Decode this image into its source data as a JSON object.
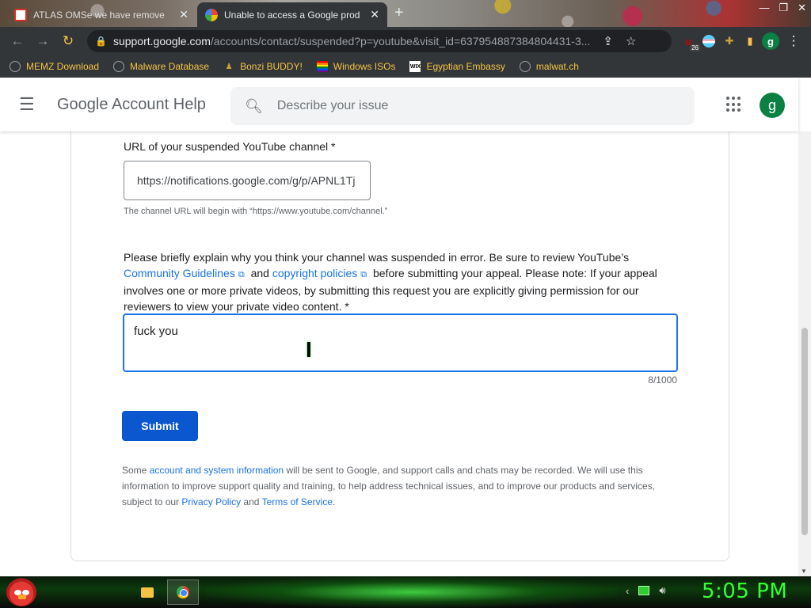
{
  "browser": {
    "tabs": [
      {
        "title": "ATLAS OMSe we have remove",
        "active": false
      },
      {
        "title": "Unable to access a Google prod",
        "active": true
      }
    ],
    "url_host": "support.google.com",
    "url_path": "/accounts/contact/suspended?p=youtube&visit_id=637954887384804431-3...",
    "extension_badge": "26",
    "profile_initial": "g",
    "bookmarks": [
      {
        "label": "MEMZ Download",
        "icon": "globe-icon"
      },
      {
        "label": "Malware Database",
        "icon": "globe-icon"
      },
      {
        "label": "Bonzi BUDDY!",
        "icon": "bonzi-icon"
      },
      {
        "label": "Windows ISOs",
        "icon": "rainbow-flag-icon"
      },
      {
        "label": "Egyptian Embassy",
        "icon": "wix-icon"
      },
      {
        "label": "malwat.ch",
        "icon": "globe-icon"
      }
    ]
  },
  "header": {
    "title": "Google Account Help",
    "search_placeholder": "Describe your issue",
    "avatar_initial": "g"
  },
  "form": {
    "url_label": "URL of your suspended YouTube channel *",
    "url_value": "https://notifications.google.com/g/p/APNL1Tj",
    "url_hint": "The channel URL will begin with “https://www.youtube.com/channel.”",
    "explain_pre": "Please briefly explain why you think your channel was suspended in error. Be sure to review YouTube’s",
    "community_link": "Community Guidelines",
    "and_text": "and",
    "copyright_link": "copyright policies",
    "explain_post": "before submitting your appeal. Please note: If your appeal involves one or more private videos, by submitting this request you are explicitly giving permission for our reviewers to view your private video content. *",
    "explain_value": "fuck you",
    "char_count": "8/1000",
    "submit_label": "Submit",
    "disclaimer_pre": "Some",
    "disclaimer_link": "account and system information",
    "disclaimer_mid": "will be sent to Google, and support calls and chats may be recorded. We will use this information to improve support quality and training, to help address technical issues, and to improve our products and services, subject to our",
    "privacy_link": "Privacy Policy",
    "disclaimer_and": "and",
    "terms_link": "Terms of Service",
    "disclaimer_end": "."
  },
  "taskbar": {
    "clock": "5:05 PM"
  },
  "colors": {
    "link": "#1a73e8",
    "submit": "#0b57d0",
    "focus_border": "#1a73e8",
    "clock": "#33ff33",
    "bookmark_text": "#f6c344"
  }
}
